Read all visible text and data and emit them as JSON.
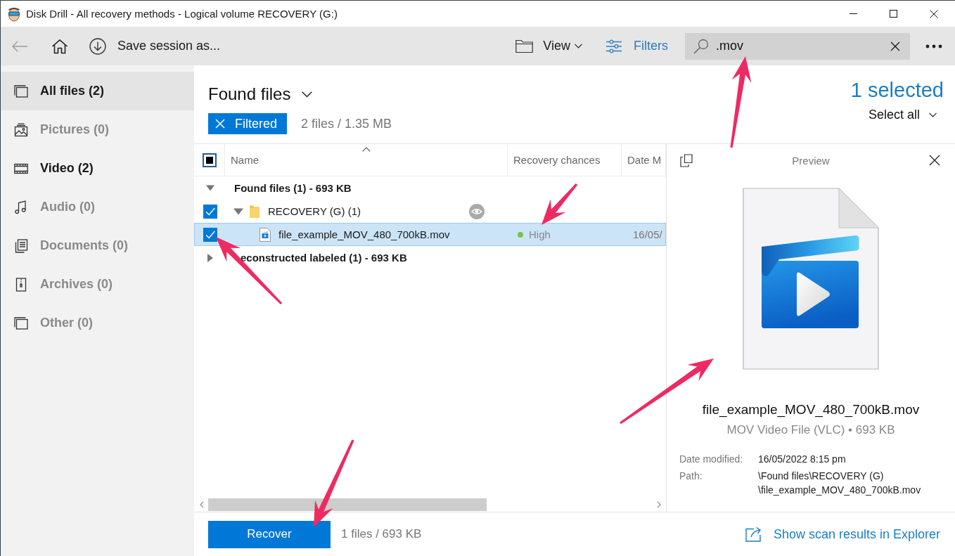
{
  "window": {
    "title": "Disk Drill - All recovery methods - Logical volume RECOVERY (G:)"
  },
  "toolbar": {
    "back": {
      "disabled": true
    },
    "save_session": "Save session as...",
    "view": "View",
    "filters": "Filters",
    "search": {
      "value": ".mov"
    }
  },
  "sidebar": {
    "items": [
      {
        "kind": "all",
        "label": "All files (2)",
        "selected": true,
        "disabled": false
      },
      {
        "kind": "pictures",
        "label": "Pictures (0)",
        "selected": false,
        "disabled": true
      },
      {
        "kind": "video",
        "label": "Video (2)",
        "selected": false,
        "disabled": false
      },
      {
        "kind": "audio",
        "label": "Audio (0)",
        "selected": false,
        "disabled": true
      },
      {
        "kind": "documents",
        "label": "Documents (0)",
        "selected": false,
        "disabled": true
      },
      {
        "kind": "archives",
        "label": "Archives (0)",
        "selected": false,
        "disabled": true
      },
      {
        "kind": "other",
        "label": "Other (0)",
        "selected": false,
        "disabled": true
      }
    ]
  },
  "header": {
    "title": "Found files",
    "filter_chip": "Filtered",
    "summary": "2 files / 1.35 MB",
    "selection": "1 selected",
    "select_all": "Select all"
  },
  "table": {
    "select_all_checkbox": {
      "indeterminate": true
    },
    "columns": [
      {
        "label": "Name",
        "sorted": true
      },
      {
        "label": "Recovery chances",
        "sorted": false
      },
      {
        "label": "Date M",
        "sorted": false
      }
    ],
    "rows": [
      {
        "kind": "group",
        "label": "Found files (1) - 693 KB",
        "expanded": true,
        "selected": false,
        "hovered": false,
        "children": [
          {
            "kind": "folder",
            "label": "RECOVERY (G) (1)",
            "checked": true,
            "expanded": true,
            "selected": false,
            "hovered": true,
            "children": [
              {
                "kind": "file",
                "label": "file_example_MOV_480_700kB.mov",
                "checked": true,
                "selected": true,
                "hovered": false,
                "chance": "High",
                "color": "#7cc242",
                "date": "16/05/"
              }
            ]
          }
        ]
      },
      {
        "kind": "group",
        "label": "econstructed labeled (1) - 693 KB",
        "expanded": false,
        "selected": false,
        "hovered": false
      }
    ]
  },
  "preview": {
    "title": "Preview",
    "file_name": "file_example_MOV_480_700kB.mov",
    "file_info": "MOV Video File (VLC) • 693 KB",
    "details": [
      {
        "label": "Date modified:",
        "value": "16/05/2022 8:15 pm"
      },
      {
        "label": "Path:",
        "value": "\\Found files\\RECOVERY (G)\\file_example_MOV_480_700kB.mov"
      }
    ]
  },
  "bottom_bar": {
    "recover_button": "Recover",
    "summary": "1 files / 693 KB",
    "explorer_link": "Show scan results in Explorer"
  }
}
